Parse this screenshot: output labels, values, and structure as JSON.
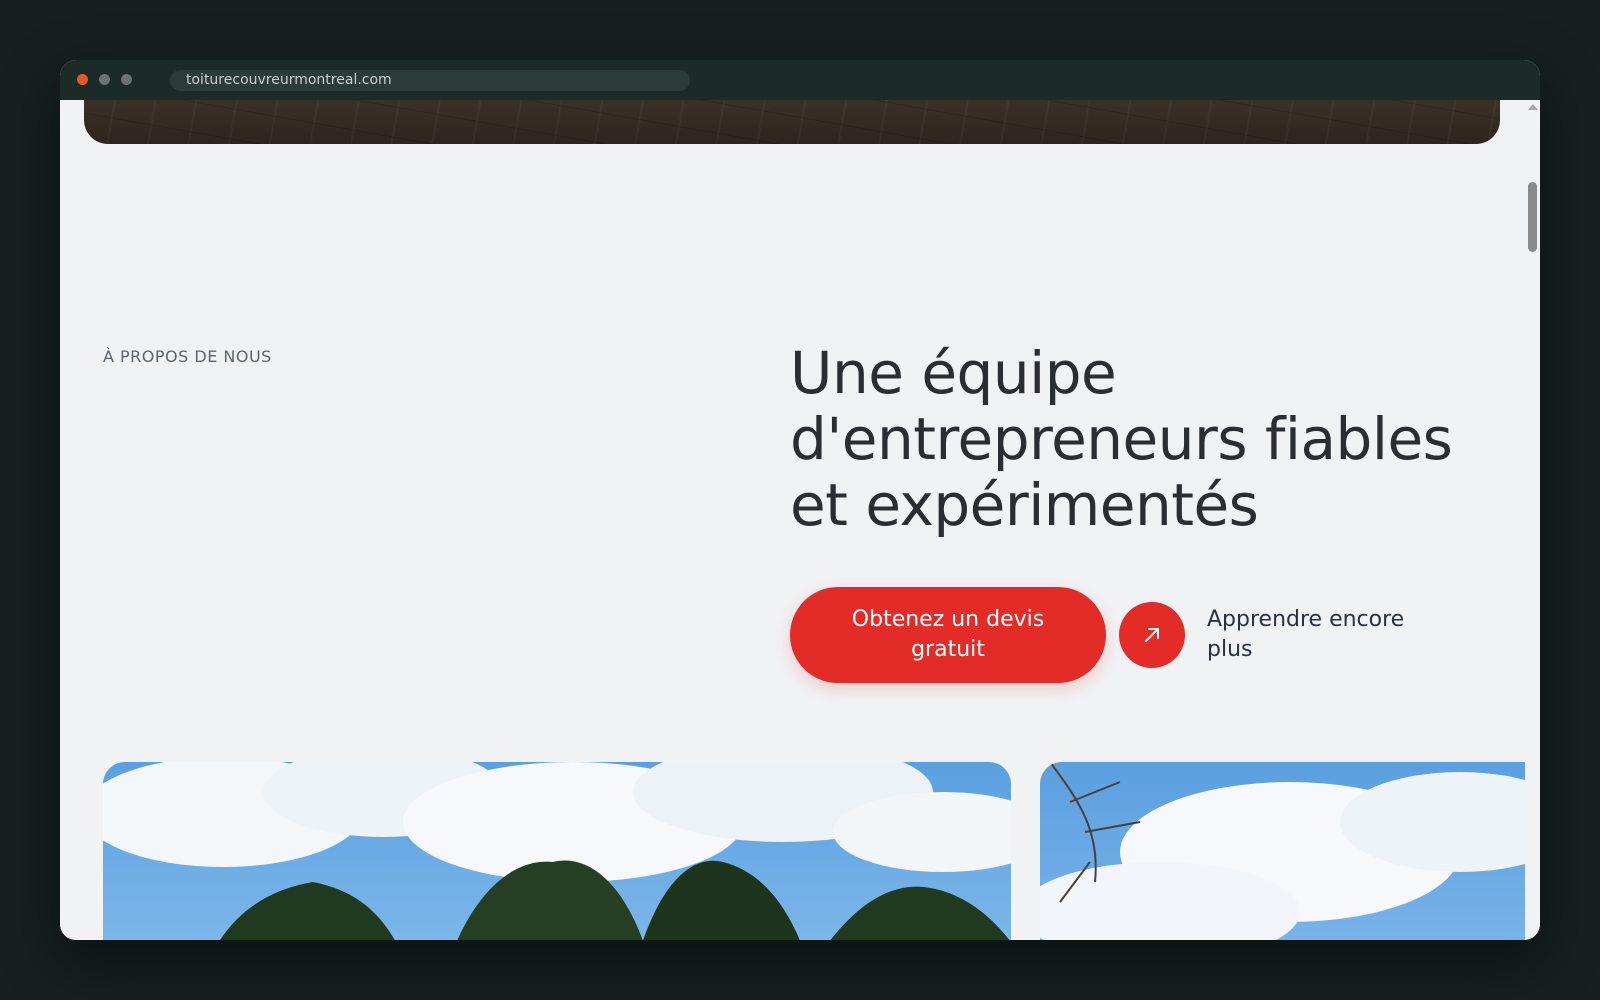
{
  "browser": {
    "url": "toiturecouvreurmontreal.com"
  },
  "about": {
    "eyebrow": "À PROPOS DE NOUS",
    "headline_line1": "Une équipe",
    "headline_line2": "d'entrepreneurs fiables",
    "headline_line3": "et expérimentés",
    "cta_primary": "Obtenez un devis gratuit",
    "cta_secondary": "Apprendre encore plus",
    "cta_secondary_icon": "arrow-up-right-icon"
  },
  "colors": {
    "accent": "#e32b28",
    "page_background": "#f1f2f4",
    "frame_background": "#15201f",
    "headline_text": "#2a2d31"
  }
}
